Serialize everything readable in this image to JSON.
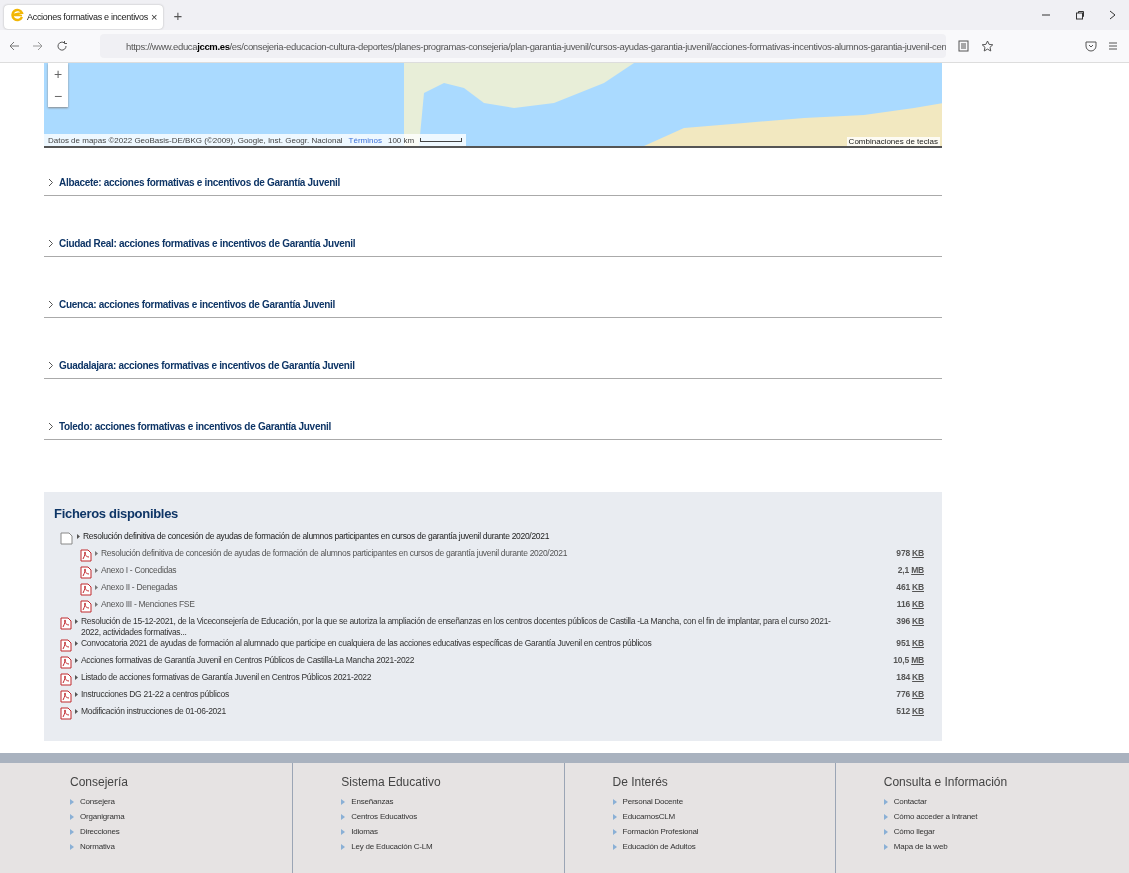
{
  "browser": {
    "tab_title": "Acciones formativas e incentivos",
    "tab_close": "×",
    "new_tab": "+",
    "url_prefix": "https://www.educa",
    "url_domain": "jccm.es",
    "url_path": "/es/consejeria-educacion-cultura-deportes/planes-programas-consejeria/plan-garantia-juvenil/cursos-ayudas-garantia-juvenil/acciones-formativas-incentivos-alumnos-garantia-juvenil-cen"
  },
  "map": {
    "zoom_in": "+",
    "zoom_out": "−",
    "attribution": "Datos de mapas ©2022 GeoBasis-DE/BKG (©2009), Google, Inst. Geogr. Nacional",
    "terms": "Términos",
    "scale": "100 km",
    "shortcuts": "Combinaciones de teclas"
  },
  "sections": [
    {
      "title": "Albacete: acciones formativas e incentivos de Garantía Juvenil",
      "expanded": false
    },
    {
      "title": "Ciudad Real: acciones formativas e incentivos de Garantía Juvenil",
      "expanded": false
    },
    {
      "title": "Cuenca: acciones formativas e incentivos de Garantía Juvenil",
      "expanded": false
    },
    {
      "title": "Guadalajara: acciones formativas e incentivos de Garantía Juvenil",
      "expanded": false
    },
    {
      "title": "Toledo: acciones formativas e incentivos de Garantía Juvenil",
      "expanded": false
    }
  ],
  "files": {
    "title": "Ficheros disponibles",
    "items": [
      {
        "kind": "folder",
        "name": "Resolución definitiva de concesión de ayudas de formación de alumnos participantes en cursos de garantía juvenil durante 2020/2021",
        "children": [
          {
            "kind": "pdf",
            "name": "Resolución definitiva de concesión de ayudas de formación de alumnos participantes en cursos de garantía juvenil durante 2020/2021",
            "size": "978",
            "unit": "KB"
          },
          {
            "kind": "pdf",
            "name": "Anexo I - Concedidas",
            "size": "2,1",
            "unit": "MB"
          },
          {
            "kind": "pdf",
            "name": "Anexo II - Denegadas",
            "size": "461",
            "unit": "KB"
          },
          {
            "kind": "pdf",
            "name": "Anexo III - Menciones FSE",
            "size": "116",
            "unit": "KB"
          }
        ]
      },
      {
        "kind": "pdf",
        "name": "Resolución de 15-12-2021, de la Viceconsejería de Educación, por la que se autoriza la ampliación de enseñanzas en los centros docentes públicos de Castilla -La Mancha, con el fin de implantar, para el curso 2021-2022, actividades formativas...",
        "size": "396",
        "unit": "KB"
      },
      {
        "kind": "pdf",
        "name": "Convocatoria 2021 de ayudas de formación al alumnado que participe en cualquiera de las acciones educativas específicas de Garantía Juvenil en centros públicos",
        "size": "951",
        "unit": "KB"
      },
      {
        "kind": "pdf",
        "name": "Acciones formativas de Garantía Juvenil en Centros Públicos de Castilla-La Mancha 2021-2022",
        "size": "10,5",
        "unit": "MB"
      },
      {
        "kind": "pdf",
        "name": "Listado de acciones formativas de Garantía Juvenil en Centros Públicos 2021-2022",
        "size": "184",
        "unit": "KB"
      },
      {
        "kind": "pdf",
        "name": "Instrucciones DG 21-22 a centros públicos",
        "size": "776",
        "unit": "KB"
      },
      {
        "kind": "pdf",
        "name": "Modificación instrucciones de 01-06-2021",
        "size": "512",
        "unit": "KB"
      }
    ]
  },
  "footer": [
    {
      "title": "Consejería",
      "links": [
        "Consejera",
        "Organigrama",
        "Direcciones",
        "Normativa"
      ]
    },
    {
      "title": "Sistema Educativo",
      "links": [
        "Enseñanzas",
        "Centros Educativos",
        "Idiomas",
        "Ley de Educación C-LM"
      ]
    },
    {
      "title": "De Interés",
      "links": [
        "Personal Docente",
        "EducamosCLM",
        "Formación Profesional",
        "Educación de Adultos"
      ]
    },
    {
      "title": "Consulta e Información",
      "links": [
        "Contactar",
        "Cómo acceder a Intranet",
        "Cómo llegar",
        "Mapa de la web"
      ]
    }
  ]
}
